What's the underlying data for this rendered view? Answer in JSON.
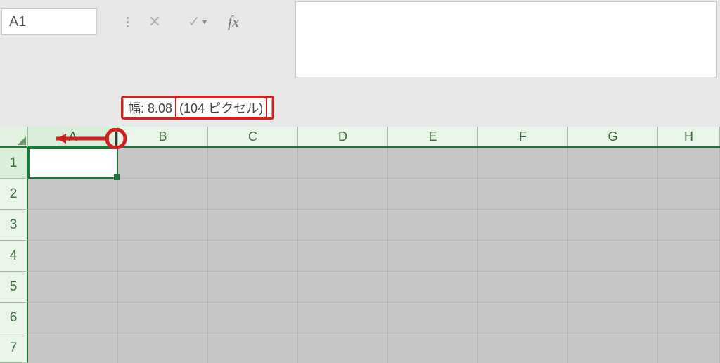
{
  "nameBox": {
    "value": "A1"
  },
  "formulaBar": {
    "value": ""
  },
  "tooltip": {
    "label": "幅: 8.08",
    "highlight": "(104 ピクセル)"
  },
  "columns": [
    "A",
    "B",
    "C",
    "D",
    "E",
    "F",
    "G",
    "H"
  ],
  "rows": [
    "1",
    "2",
    "3",
    "4",
    "5",
    "6",
    "7"
  ],
  "icons": {
    "cancel": "✕",
    "enter": "✓",
    "fx": "fx",
    "dropdown": "▾"
  }
}
